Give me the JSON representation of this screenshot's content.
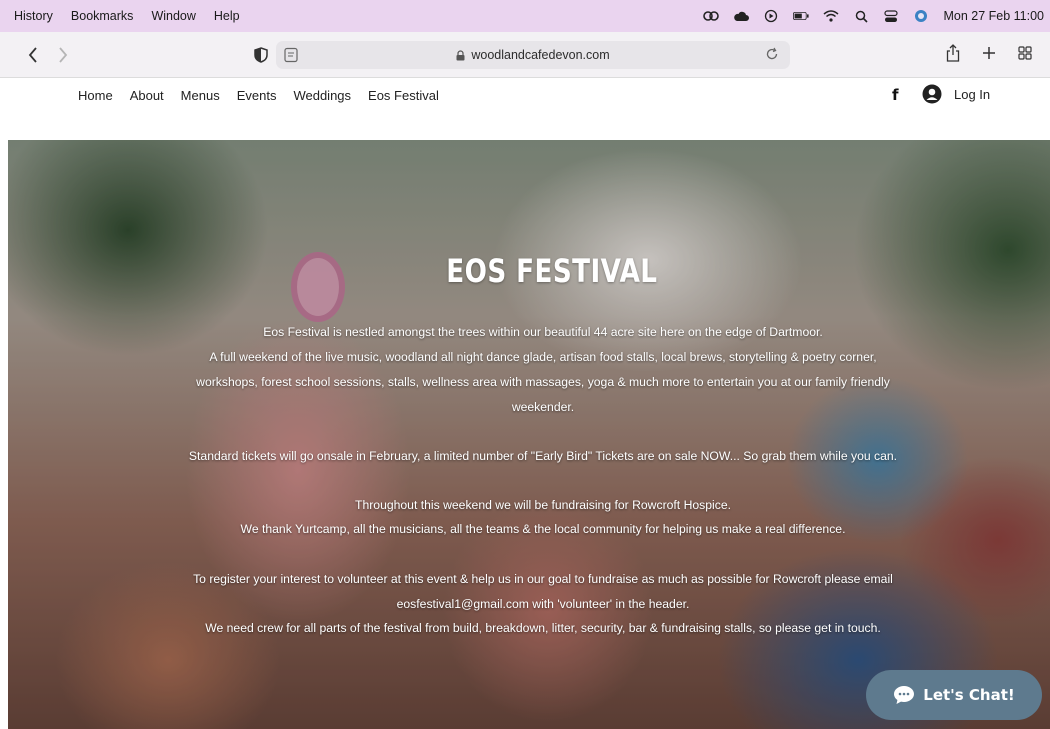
{
  "menubar": {
    "items": [
      "History",
      "Bookmarks",
      "Window",
      "Help"
    ],
    "clock": "Mon 27 Feb  11:00"
  },
  "browser": {
    "url": "woodlandcafedevon.com"
  },
  "site": {
    "nav": [
      "Home",
      "About",
      "Menus",
      "Events",
      "Weddings",
      "Eos Festival"
    ],
    "facebook": "f",
    "login": "Log In"
  },
  "hero": {
    "title": "EOS FESTIVAL",
    "lines": [
      "Eos Festival is nestled amongst the trees within our beautiful 44 acre site here on the edge of Dartmoor.",
      "A full weekend of the live music, woodland all night dance glade, artisan food stalls, local brews, storytelling & poetry corner,",
      "workshops, forest school sessions, stalls, wellness area with massages, yoga & much more to entertain you at our family friendly",
      "weekender.",
      "Standard tickets will go onsale  in February, a limited number of \"Early Bird\" Tickets are on sale NOW... So grab them while you can.",
      "Throughout this weekend we will be fundraising for Rowcroft Hospice.",
      "We thank Yurtcamp, all the musicians, all the teams & the local community for helping us make a real difference.",
      "To register your interest to volunteer at this event & help us in our goal to fundraise as much as possible for Rowcroft please email",
      "eosfestival1@gmail.com with 'volunteer' in the header.",
      "We need crew for all parts of the festival from build, breakdown, litter, security, bar & fundraising stalls, so please get in touch."
    ]
  },
  "chat": {
    "label": "Let's Chat!"
  },
  "colors": {
    "menubar": "#ead4ef",
    "chat_button": "#5e7a8e"
  }
}
